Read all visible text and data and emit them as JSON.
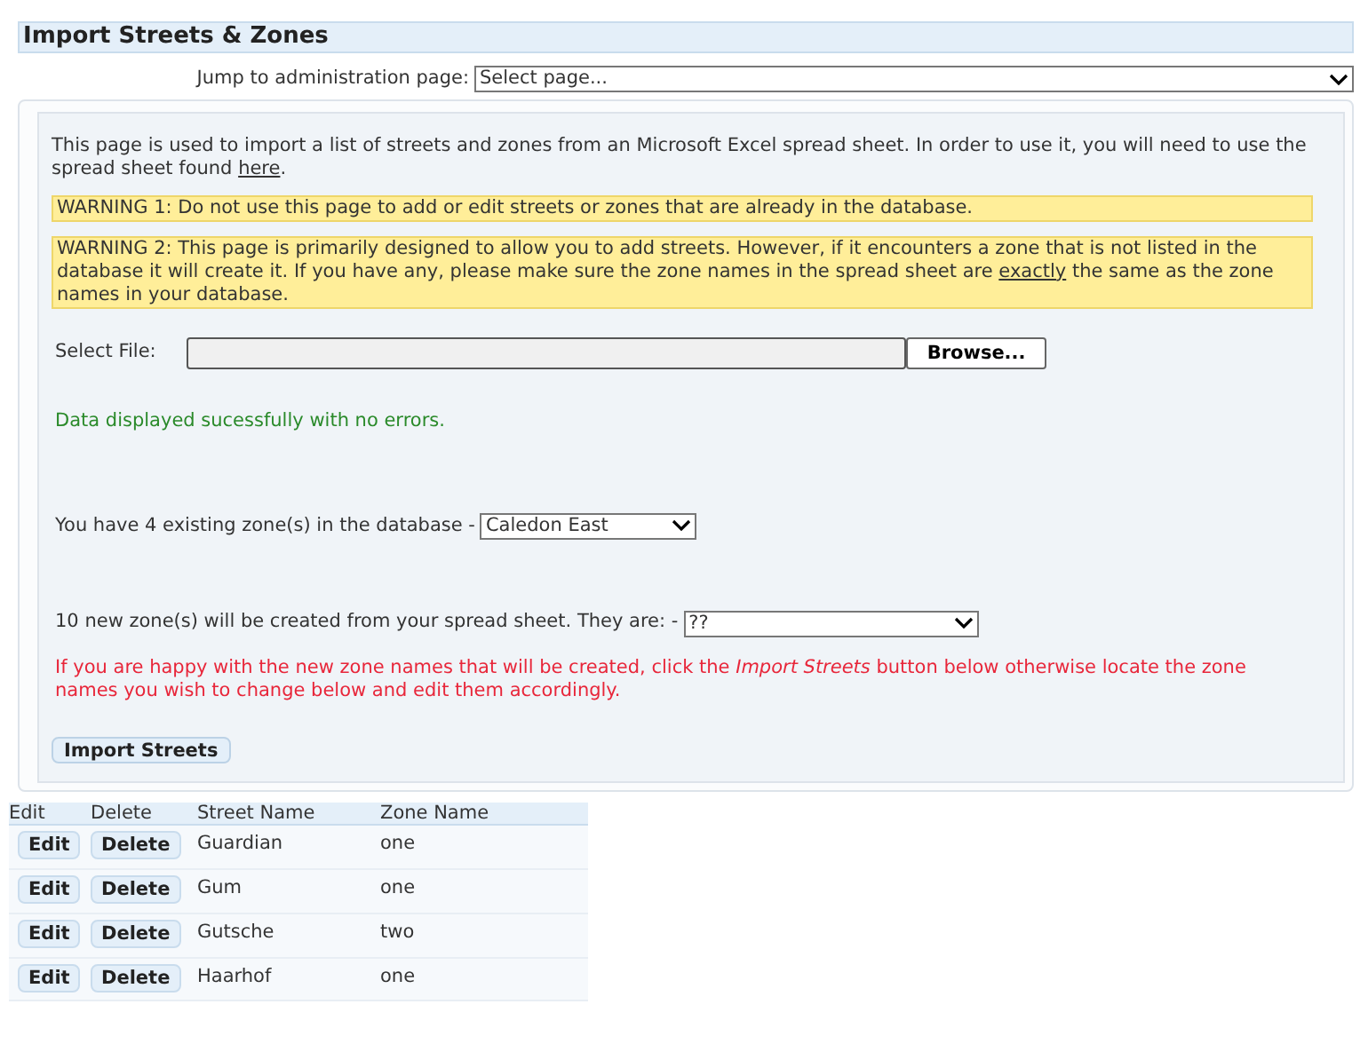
{
  "title": "Import Streets & Zones",
  "jump": {
    "label": "Jump to administration page:",
    "value": "Select page..."
  },
  "intro": {
    "before": "This page is used to import a list of streets and zones from an Microsoft Excel spread sheet. In order to use it, you will need to use the spread sheet found ",
    "link": "here",
    "after": "."
  },
  "warnings": [
    {
      "before": "WARNING 1: Do not use this page to add or edit streets or zones that are already in the database."
    },
    {
      "before": "WARNING 2: This page is primarily designed to allow you to add streets. However, if it encounters a zone that is not listed in the database it will create it. If you have any, please make sure the zone names in the spread sheet are ",
      "underlined": "exactly",
      "after": " the same as the zone names in your database."
    }
  ],
  "file": {
    "label": "Select File:",
    "button": "Browse..."
  },
  "success": "Data displayed sucessfully with no errors.",
  "existing": {
    "label": "You have 4 existing zone(s) in the database -",
    "value": "Caledon East"
  },
  "new_zones": {
    "label": "10 new zone(s) will be created from your spread sheet. They are: -",
    "value": "??"
  },
  "notice": "If you are happy with the new zone names that will be created, click the *Import Streets* button below otherwise locate the zone names you wish to change below and edit them accordingly.",
  "import_button": "Import Streets",
  "table": {
    "columns": [
      "Edit",
      "Delete",
      "Street Name",
      "Zone Name"
    ],
    "rows": [
      {
        "edit": "Edit",
        "delete": "Delete",
        "street": "Guardian",
        "zone": "one"
      },
      {
        "edit": "Edit",
        "delete": "Delete",
        "street": "Gum",
        "zone": "one"
      },
      {
        "edit": "Edit",
        "delete": "Delete",
        "street": "Gutsche",
        "zone": "two"
      },
      {
        "edit": "Edit",
        "delete": "Delete",
        "street": "Haarhof",
        "zone": "one"
      }
    ]
  }
}
